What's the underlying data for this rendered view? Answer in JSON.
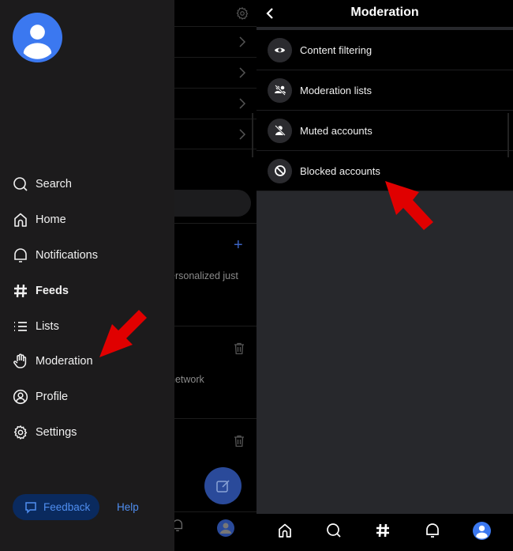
{
  "background_screen": {
    "partial_text_1": "ersonalized just",
    "partial_text_2": "network"
  },
  "drawer": {
    "nav_items": [
      {
        "label": "Search",
        "icon": "search-icon"
      },
      {
        "label": "Home",
        "icon": "home-icon"
      },
      {
        "label": "Notifications",
        "icon": "bell-icon"
      },
      {
        "label": "Feeds",
        "icon": "hash-icon",
        "active": true
      },
      {
        "label": "Lists",
        "icon": "list-icon"
      },
      {
        "label": "Moderation",
        "icon": "hand-icon"
      },
      {
        "label": "Profile",
        "icon": "user-circle-icon"
      },
      {
        "label": "Settings",
        "icon": "gear-icon"
      }
    ],
    "feedback_label": "Feedback",
    "help_label": "Help"
  },
  "moderation": {
    "title": "Moderation",
    "items": [
      {
        "label": "Content filtering",
        "icon": "eye-icon"
      },
      {
        "label": "Moderation lists",
        "icon": "users-slash-icon"
      },
      {
        "label": "Muted accounts",
        "icon": "user-slash-icon"
      },
      {
        "label": "Blocked accounts",
        "icon": "block-icon"
      }
    ]
  },
  "tabbar": {
    "tabs": [
      "home-icon",
      "search-icon",
      "hash-icon",
      "bell-icon",
      "avatar-icon"
    ]
  },
  "colors": {
    "accent": "#4f8ef0",
    "avatar_blue": "#3b78f0",
    "annotation_arrow": "#e00000",
    "drawer_bg": "#1c1b1c"
  }
}
